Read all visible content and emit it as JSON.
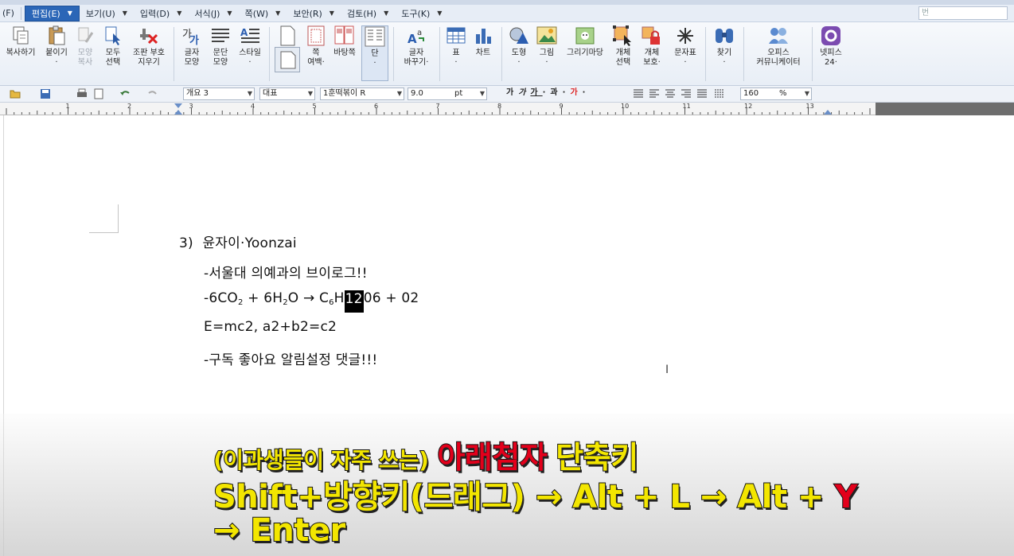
{
  "menubar": {
    "items": [
      {
        "label": "(F)"
      },
      {
        "label": "편집(E)",
        "active": true
      },
      {
        "label": "보기(U)"
      },
      {
        "label": "입력(D)"
      },
      {
        "label": "서식(J)"
      },
      {
        "label": "쪽(W)"
      },
      {
        "label": "보안(R)"
      },
      {
        "label": "검토(H)"
      },
      {
        "label": "도구(K)"
      }
    ],
    "search_placeholder": "번"
  },
  "ribbon": {
    "buttons": [
      {
        "label": "복사하기"
      },
      {
        "label": "붙이기\n·"
      },
      {
        "label": "모양\n복사",
        "disabled": true
      },
      {
        "label": "모두\n선택"
      },
      {
        "label": "조판 부호\n지우기"
      },
      {
        "label": "글자\n모양"
      },
      {
        "label": "문단\n모양"
      },
      {
        "label": "스타일\n·"
      },
      {
        "label": ""
      },
      {
        "label": "쪽\n여백·"
      },
      {
        "label": "바탕쪽"
      },
      {
        "label": "단\n·"
      },
      {
        "label": "글자\n바꾸기·"
      },
      {
        "label": "표\n·"
      },
      {
        "label": "차트"
      },
      {
        "label": "도형\n·"
      },
      {
        "label": "그림\n·"
      },
      {
        "label": "그리기마당"
      },
      {
        "label": "개체\n선택"
      },
      {
        "label": "개체\n보호·"
      },
      {
        "label": "문자표\n·"
      },
      {
        "label": "찾기\n·"
      },
      {
        "label": "오피스\n커뮤니케이터"
      },
      {
        "label": "넷피스\n24·"
      }
    ]
  },
  "format_toolbar": {
    "style": "개요 3",
    "language": "대표",
    "font": "1훈떡볶이 R",
    "size": "9.0",
    "size_unit": "pt",
    "char_buttons": [
      "가",
      "가",
      "가",
      "·",
      "과",
      "·",
      "가",
      "·"
    ],
    "zoom": "160",
    "zoom_unit": "%"
  },
  "ruler": {
    "numbers": [
      "1",
      "2",
      "3",
      "4",
      "5",
      "6",
      "7",
      "8",
      "9",
      "10",
      "11",
      "12",
      "13"
    ]
  },
  "document": {
    "line1_number": "3)",
    "line1_text": "윤자이·Yoonzai",
    "line2": "-서울대 의예과의 브이로그!!",
    "formula": {
      "a": "-6CO",
      "a_sub": "2",
      "b": " + 6H",
      "b_sub": "2",
      "c": "O → C",
      "c_sub": "6",
      "d": "H",
      "selected": "12",
      "e": "06 + 02"
    },
    "line4": "E=mc2, a2+b2=c2",
    "line5": "-구독 좋아요 알림설정 댓글!!!",
    "text_cursor": "I"
  },
  "caption": {
    "line1_part1": "(이과생들이 자주 쓰는)",
    "line1_part2": "아래첨자",
    "line1_part3": "단축키",
    "line2_part1": "Shift+방향키(드래그) → Alt + L → Alt +",
    "line2_part2": "Y",
    "line3": "→ Enter"
  },
  "colors": {
    "menu_active": "#2b66b7",
    "caption_yellow": "#f3e600",
    "caption_red": "#e3001b"
  }
}
